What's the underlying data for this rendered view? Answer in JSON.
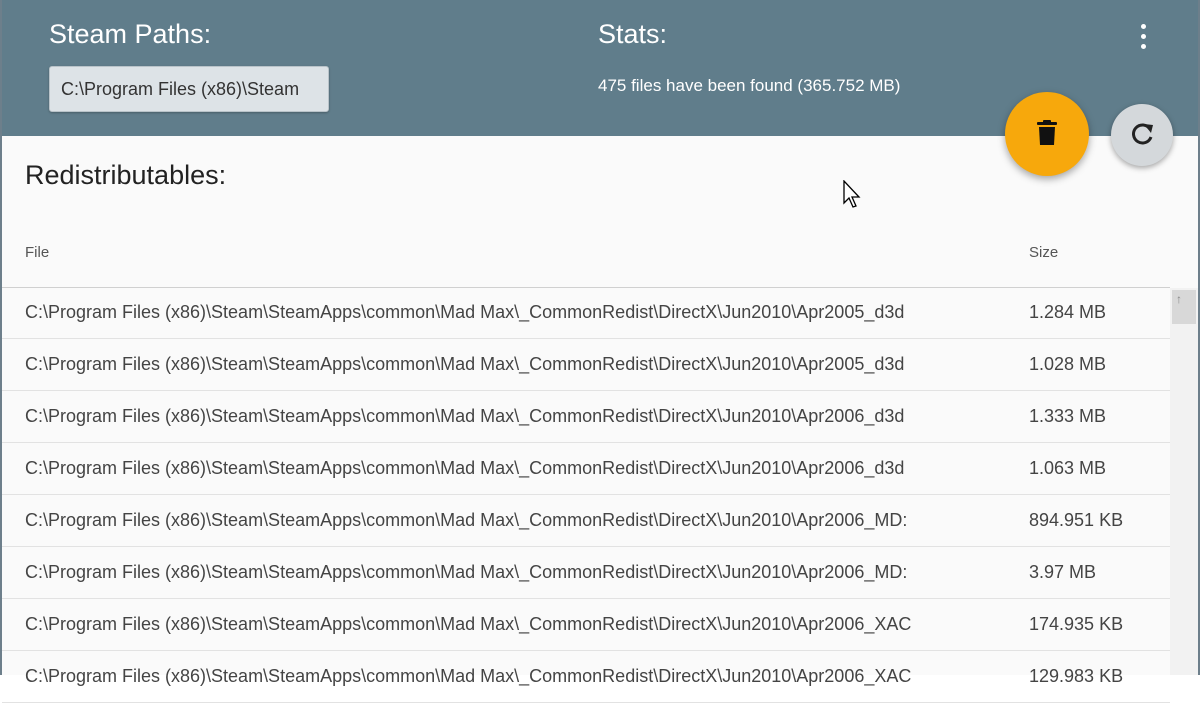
{
  "header": {
    "steam_paths_label": "Steam Paths:",
    "steam_path_value": "C:\\Program Files (x86)\\Steam",
    "stats_label": "Stats:",
    "stats_text": "475 files have been found (365.752 MB)",
    "more_icon": "more-vert-icon"
  },
  "actions": {
    "delete_icon": "trash-icon",
    "delete_color": "#f7a80c",
    "refresh_icon": "refresh-icon"
  },
  "section": {
    "title": "Redistributables:"
  },
  "table": {
    "columns": [
      "File",
      "Size"
    ],
    "rows": [
      {
        "file": "C:\\Program Files (x86)\\Steam\\SteamApps\\common\\Mad Max\\_CommonRedist\\DirectX\\Jun2010\\Apr2005_d3d",
        "size": "1.284 MB"
      },
      {
        "file": "C:\\Program Files (x86)\\Steam\\SteamApps\\common\\Mad Max\\_CommonRedist\\DirectX\\Jun2010\\Apr2005_d3d",
        "size": "1.028 MB"
      },
      {
        "file": "C:\\Program Files (x86)\\Steam\\SteamApps\\common\\Mad Max\\_CommonRedist\\DirectX\\Jun2010\\Apr2006_d3d",
        "size": "1.333 MB"
      },
      {
        "file": "C:\\Program Files (x86)\\Steam\\SteamApps\\common\\Mad Max\\_CommonRedist\\DirectX\\Jun2010\\Apr2006_d3d",
        "size": "1.063 MB"
      },
      {
        "file": "C:\\Program Files (x86)\\Steam\\SteamApps\\common\\Mad Max\\_CommonRedist\\DirectX\\Jun2010\\Apr2006_MD:",
        "size": "894.951 KB"
      },
      {
        "file": "C:\\Program Files (x86)\\Steam\\SteamApps\\common\\Mad Max\\_CommonRedist\\DirectX\\Jun2010\\Apr2006_MD:",
        "size": "3.97 MB"
      },
      {
        "file": "C:\\Program Files (x86)\\Steam\\SteamApps\\common\\Mad Max\\_CommonRedist\\DirectX\\Jun2010\\Apr2006_XAC",
        "size": "174.935 KB"
      },
      {
        "file": "C:\\Program Files (x86)\\Steam\\SteamApps\\common\\Mad Max\\_CommonRedist\\DirectX\\Jun2010\\Apr2006_XAC",
        "size": "129.983 KB"
      }
    ]
  },
  "colors": {
    "header_bg": "#607d8b",
    "accent": "#f7a80c"
  }
}
